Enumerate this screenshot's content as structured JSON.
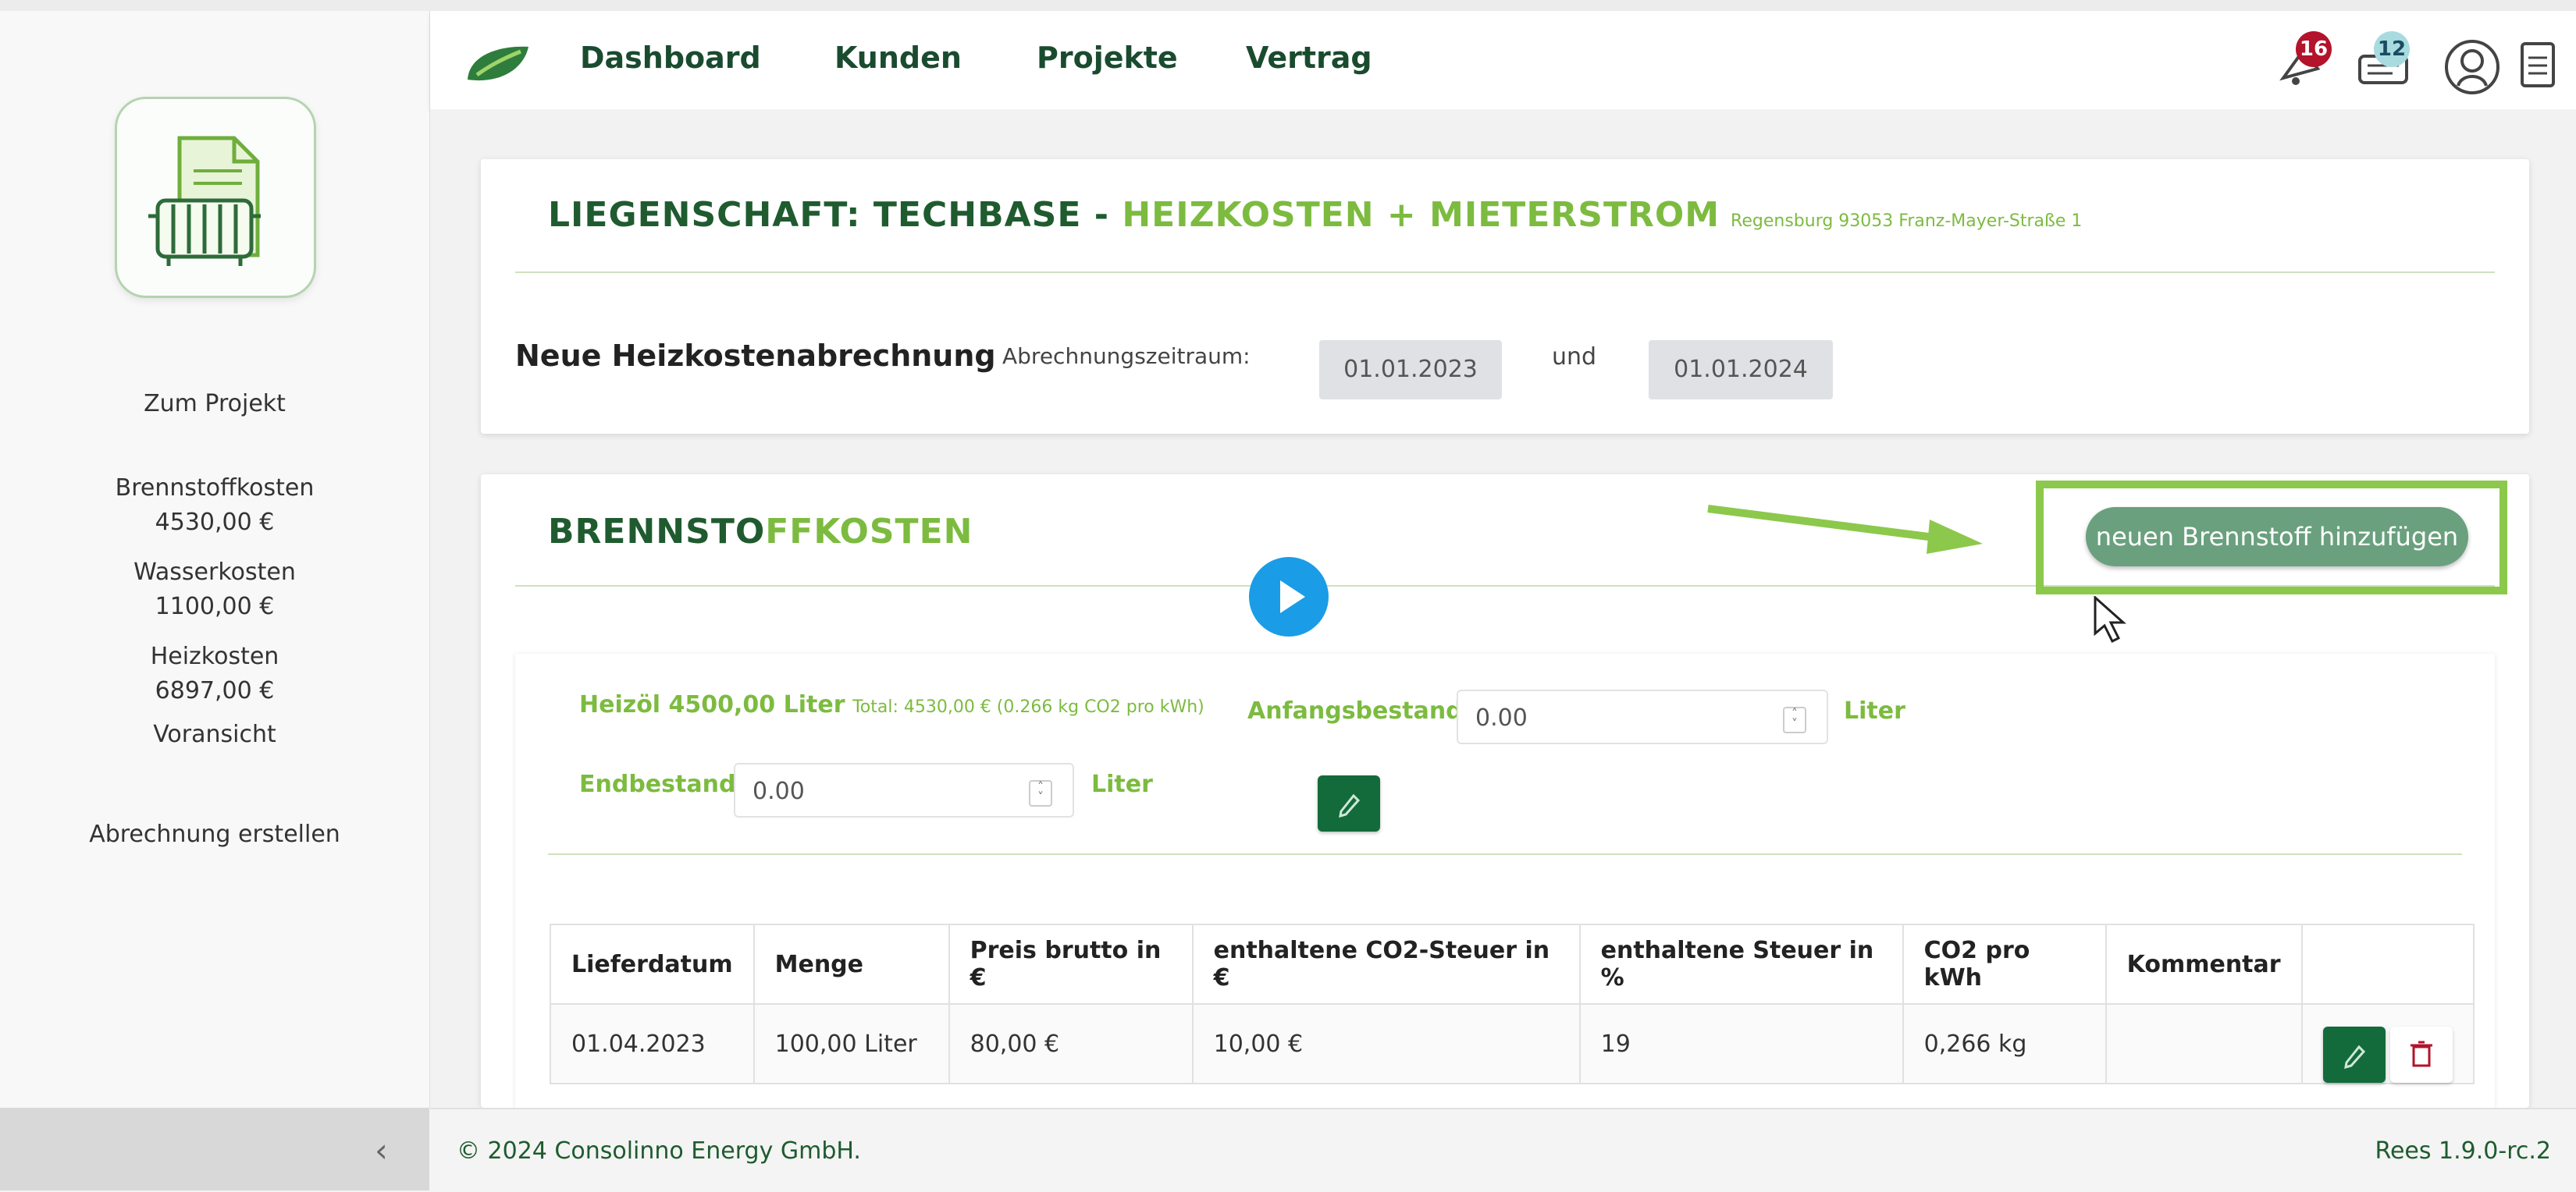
{
  "nav": {
    "links": [
      "Dashboard",
      "Kunden",
      "Projekte",
      "Vertrag"
    ],
    "notifications_count": "16",
    "messages_count": "12"
  },
  "sidebar": {
    "items": [
      {
        "label": "Zum Projekt"
      },
      {
        "label": "Brennstoffkosten",
        "value": "4530,00 €"
      },
      {
        "label": "Wasserkosten",
        "value": "1100,00 €"
      },
      {
        "label": "Heizkosten",
        "value": "6897,00 €"
      },
      {
        "label": "Voransicht"
      },
      {
        "label": "Abrechnung erstellen"
      }
    ]
  },
  "property": {
    "title_prefix": "LIEGENSCHAFT: TECHBASE - ",
    "title_accent": "HEIZKOSTEN + MIETERSTROM",
    "address": "Regensburg 93053 Franz-Mayer-Straße 1"
  },
  "billing": {
    "heading": "Neue Heizkostenabrechnung",
    "period_label": "Abrechnungszeitraum:",
    "start_date": "01.01.2023",
    "and_label": "und",
    "end_date": "01.01.2024"
  },
  "fuel": {
    "title_prefix": "BRENNSTO",
    "title_accent": "FFKOSTEN",
    "add_button": "neuen Brennstoff hinzufügen",
    "summary_bold": "Heizöl 4500,00 Liter",
    "summary_small": "Total: 4530,00 € (0.266 kg CO2 pro kWh)",
    "start_label": "Anfangsbestand:",
    "start_value": "0.00",
    "unit": "Liter",
    "end_label": "Endbestand:",
    "end_value": "0.00"
  },
  "table": {
    "headers": [
      "Lieferdatum",
      "Menge",
      "Preis brutto in €",
      "enthaltene CO2-Steuer in €",
      "enthaltene Steuer in %",
      "CO2 pro kWh",
      "Kommentar"
    ],
    "rows": [
      [
        "01.04.2023",
        "100,00 Liter",
        "80,00 €",
        "10,00 €",
        "19",
        "0,266 kg",
        ""
      ]
    ]
  },
  "footer": {
    "copyright": "© 2024 Consolinno Energy GmbH.",
    "version": "Rees 1.9.0-rc.2"
  },
  "colors": {
    "brand_dark": "#1f5b2f",
    "accent": "#7cbb3f",
    "button_green": "#136b3b",
    "highlight_box": "#8cc84b"
  },
  "icons": [
    "radiator-document-icon",
    "leaf-logo-icon",
    "bell-icon",
    "chat-icon",
    "user-circle-icon",
    "document-icon",
    "play-icon",
    "arrow-icon",
    "cursor-icon",
    "pencil-icon",
    "trash-icon",
    "chevron-left-icon"
  ]
}
